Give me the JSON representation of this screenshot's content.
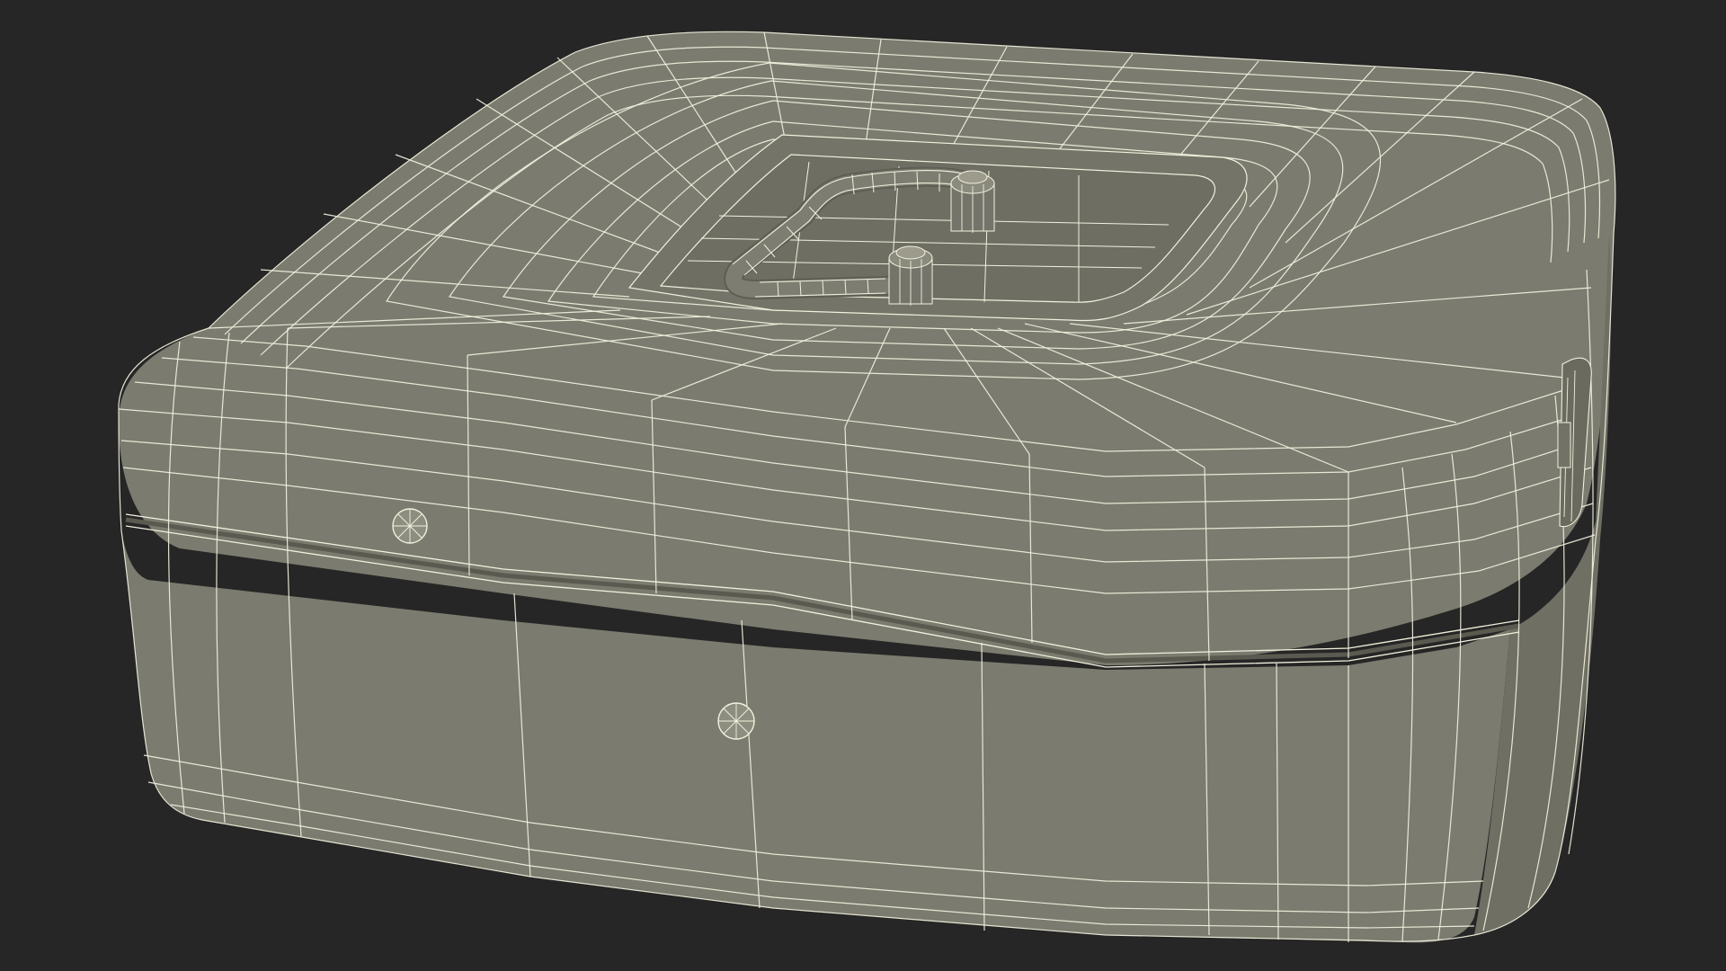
{
  "scene": {
    "subject": "wireframe-box-with-handle",
    "colors": {
      "background": "#262626",
      "surface": "#7b7b6f",
      "surface_dark": "#6d6d62",
      "wire": "#f2f1de",
      "shadow": "#5f5f55"
    }
  }
}
